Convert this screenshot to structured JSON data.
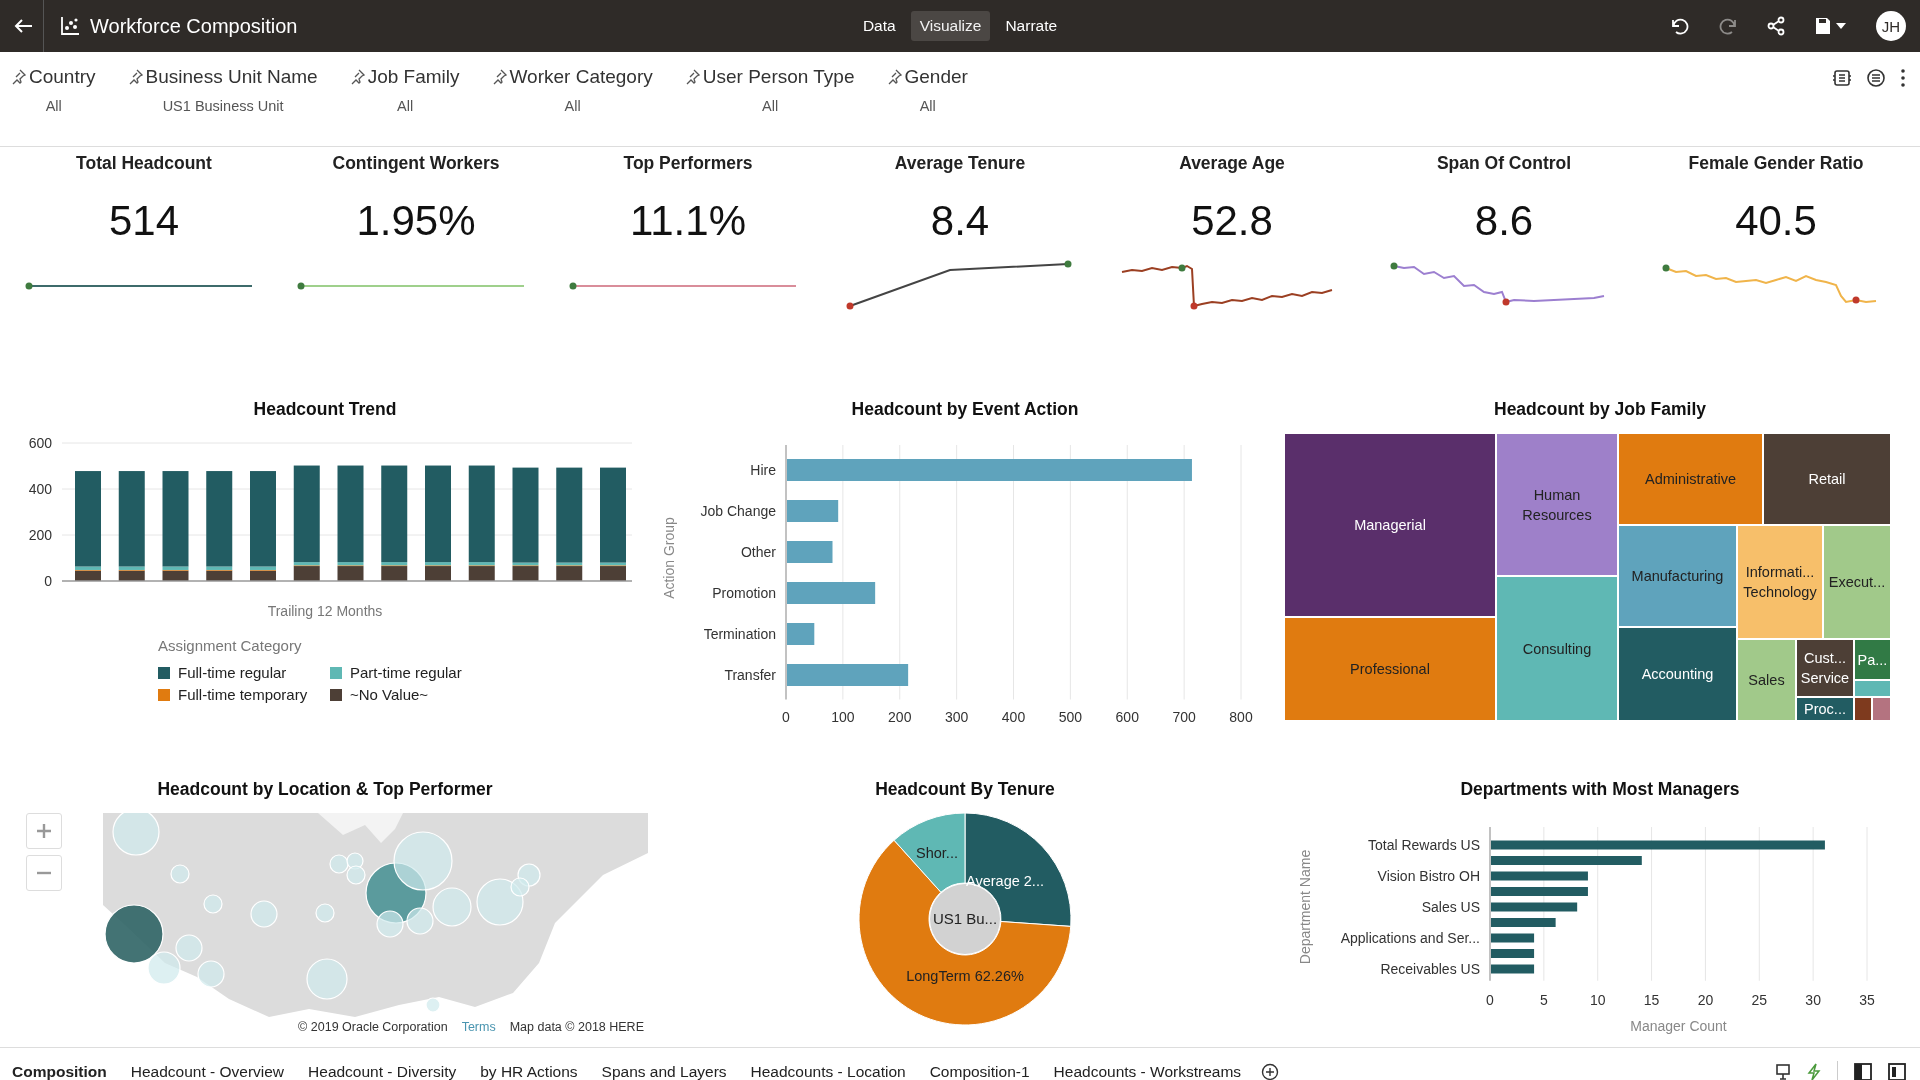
{
  "app_bar": {
    "title": "Workforce Composition",
    "modes": [
      {
        "label": "Data",
        "selected": false
      },
      {
        "label": "Visualize",
        "selected": true
      },
      {
        "label": "Narrate",
        "selected": false
      }
    ],
    "actions": [
      {
        "kind": "undo",
        "disabled": false
      },
      {
        "kind": "redo",
        "disabled": true
      },
      {
        "kind": "share",
        "disabled": false
      },
      {
        "kind": "save",
        "disabled": false
      }
    ],
    "user_initials": "JH"
  },
  "filters": [
    {
      "label": "Country",
      "value": "All"
    },
    {
      "label": "Business Unit Name",
      "value": "US1 Business Unit"
    },
    {
      "label": "Job Family",
      "value": "All"
    },
    {
      "label": "Worker Category",
      "value": "All"
    },
    {
      "label": "User Person Type",
      "value": "All"
    },
    {
      "label": "Gender",
      "value": "All"
    }
  ],
  "kpis": [
    {
      "title": "Total Headcount",
      "value": "514",
      "color": "#3d6b6b"
    },
    {
      "title": "Contingent Workers",
      "value": "1.95%",
      "color": "#9fd08c"
    },
    {
      "title": "Top Performers",
      "value": "11.1%",
      "color": "#d98d9a"
    },
    {
      "title": "Average Tenure",
      "value": "8.4",
      "color": "#444444"
    },
    {
      "title": "Average Age",
      "value": "52.8",
      "color": "#9b3f22"
    },
    {
      "title": "Span Of Control",
      "value": "8.6",
      "color": "#9c7fd0"
    },
    {
      "title": "Female Gender Ratio",
      "value": "40.5",
      "color": "#f0b44a"
    }
  ],
  "headcount_trend": {
    "title": "Headcount Trend",
    "legend_title": "Assignment Category",
    "chart_data": {
      "type": "bar",
      "stacked": true,
      "xlabel": "Trailing 12 Months",
      "ylim": [
        0,
        600
      ],
      "yticks": [
        0,
        200,
        400,
        600
      ],
      "series": [
        {
          "name": "Full-time regular",
          "color": "#225c62",
          "values": [
            415,
            415,
            415,
            415,
            415,
            420,
            420,
            420,
            420,
            420,
            413,
            413,
            413
          ]
        },
        {
          "name": "Part-time regular",
          "color": "#5fb8b4",
          "values": [
            15,
            15,
            15,
            15,
            15,
            14,
            14,
            14,
            14,
            14,
            12,
            12,
            12
          ]
        },
        {
          "name": "Full-time temporary",
          "color": "#e07b10",
          "values": [
            3,
            3,
            3,
            3,
            3,
            3,
            3,
            3,
            3,
            3,
            3,
            3,
            3
          ]
        },
        {
          "name": "~No Value~",
          "color": "#4d3f36",
          "values": [
            45,
            45,
            45,
            45,
            45,
            65,
            65,
            65,
            65,
            65,
            65,
            65,
            65
          ]
        }
      ]
    }
  },
  "event_action": {
    "title": "Headcount by Event Action",
    "chart_data": {
      "type": "bar",
      "orientation": "horizontal",
      "ylabel": "Action Group",
      "categories": [
        "Hire",
        "Job Change",
        "Other",
        "Promotion",
        "Termination",
        "Transfer"
      ],
      "series": [
        {
          "color": "#5fa3bc",
          "values": [
            712,
            90,
            80,
            155,
            48,
            213
          ]
        }
      ],
      "grid": true,
      "xlim": [
        0,
        800
      ],
      "xticks": [
        0,
        100,
        200,
        300,
        400,
        500,
        600,
        700,
        800
      ]
    }
  },
  "job_family": {
    "title": "Headcount by Job Family",
    "tiles": [
      {
        "label": "Managerial",
        "color": "#5a2f6b"
      },
      {
        "label": "Professional",
        "color": "#e07b10"
      },
      {
        "label": "Human Resources",
        "color": "#9e80c9"
      },
      {
        "label": "Consulting",
        "color": "#5fb8b4"
      },
      {
        "label": "Administrative",
        "color": "#e07b10"
      },
      {
        "label": "Retail",
        "color": "#4d3f36"
      },
      {
        "label": "Manufacturing",
        "color": "#5fa3bc"
      },
      {
        "label": "Accounting",
        "color": "#225c62"
      },
      {
        "label": "Informati... Technology",
        "color": "#f7bf6a"
      },
      {
        "label": "Execut...",
        "color": "#a1c98a"
      },
      {
        "label": "Sales",
        "color": "#a1c98a"
      },
      {
        "label": "Cust... Service",
        "color": "#4d3f36"
      },
      {
        "label": "Proc...",
        "color": "#225c62"
      },
      {
        "label": "Pa...",
        "color": "#317a45"
      },
      {
        "color": "#5fb8b4"
      },
      {
        "color": "#7e3a1e"
      },
      {
        "color": "#b47380"
      }
    ]
  },
  "location_map": {
    "title": "Headcount by Location & Top Performer",
    "copyright": "© 2019 Oracle Corporation",
    "terms": "Terms",
    "map_data": "Map data © 2018 HERE"
  },
  "tenure": {
    "title": "Headcount By Tenure",
    "center_label": "US1 Bu...",
    "slices": [
      {
        "label": "Average 2...",
        "color": "#225c62"
      },
      {
        "label": "LongTerm 62.26%",
        "color": "#e07b10"
      },
      {
        "label": "Shor...",
        "color": "#5fb8b4"
      }
    ]
  },
  "managers": {
    "title": "Departments with Most Managers",
    "chart_data": {
      "type": "bar",
      "orientation": "horizontal",
      "xlabel": "Manager Count",
      "ylabel": "Department Name",
      "categories": [
        "Total Rewards US",
        null,
        "Vision Bistro OH",
        null,
        "Sales US",
        null,
        "Applications and Ser...",
        null,
        "Receivables US"
      ],
      "series": [
        {
          "color": "#225c62",
          "values": [
            31,
            14,
            9,
            9,
            8,
            6,
            4,
            4,
            4
          ]
        }
      ],
      "grid": true,
      "xlim": [
        0,
        35
      ],
      "xticks": [
        0,
        5,
        10,
        15,
        20,
        25,
        30,
        35
      ]
    }
  },
  "sheet_tabs": [
    {
      "label": "Composition",
      "selected": true
    },
    {
      "label": "Headcount - Overview",
      "selected": false
    },
    {
      "label": "Headcount - Diversity",
      "selected": false
    },
    {
      "label": "by HR Actions",
      "selected": false
    },
    {
      "label": "Spans and Layers",
      "selected": false
    },
    {
      "label": "Headcounts - Location",
      "selected": false
    },
    {
      "label": "Composition-1",
      "selected": false
    },
    {
      "label": "Headcounts - Workstreams",
      "selected": false
    }
  ]
}
